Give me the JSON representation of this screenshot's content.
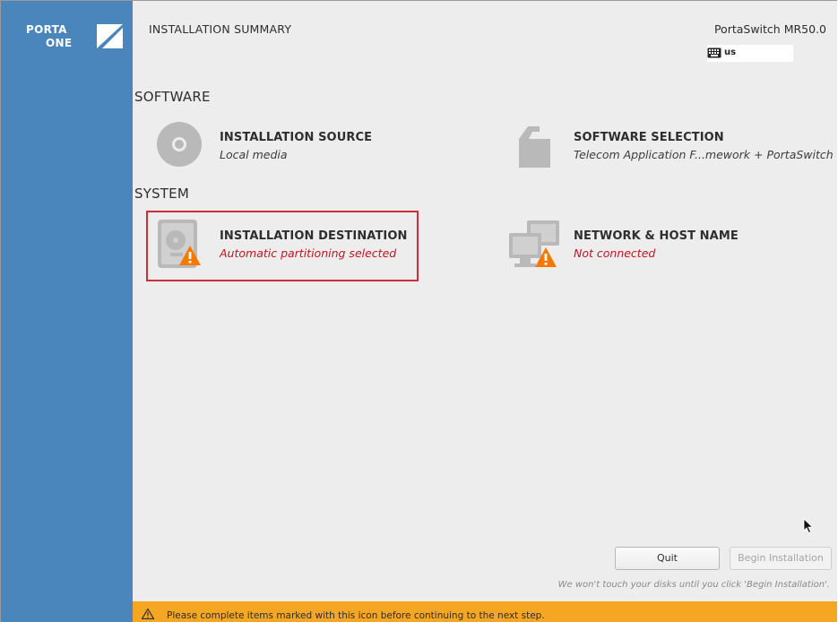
{
  "sidebar": {
    "logo_line1": "PORTA",
    "logo_line2": "ONE",
    "color": "#4a85bb"
  },
  "header": {
    "title": "INSTALLATION SUMMARY",
    "product": "PortaSwitch MR50.0",
    "keyboard_layout": "us"
  },
  "sections": {
    "software": {
      "heading": "SOFTWARE",
      "spokes": [
        {
          "title": "INSTALLATION SOURCE",
          "status": "Local media",
          "icon": "optical-disc-icon"
        },
        {
          "title": "SOFTWARE SELECTION",
          "status": "Telecom Application F...mework + PortaSwitch",
          "icon": "package-icon"
        }
      ]
    },
    "system": {
      "heading": "SYSTEM",
      "spokes": [
        {
          "title": "INSTALLATION DESTINATION",
          "status": "Automatic partitioning selected",
          "icon": "hard-disk-icon",
          "warning": true
        },
        {
          "title": "NETWORK & HOST NAME",
          "status": "Not connected",
          "icon": "network-icon",
          "warning": true
        }
      ]
    }
  },
  "actions": {
    "quit_label": "Quit",
    "begin_label": "Begin Installation",
    "hint": "We won't touch your disks until you click 'Begin Installation'."
  },
  "warning_bar": {
    "message": "Please complete items marked with this icon before continuing to the next step.",
    "color": "#f5a623"
  }
}
